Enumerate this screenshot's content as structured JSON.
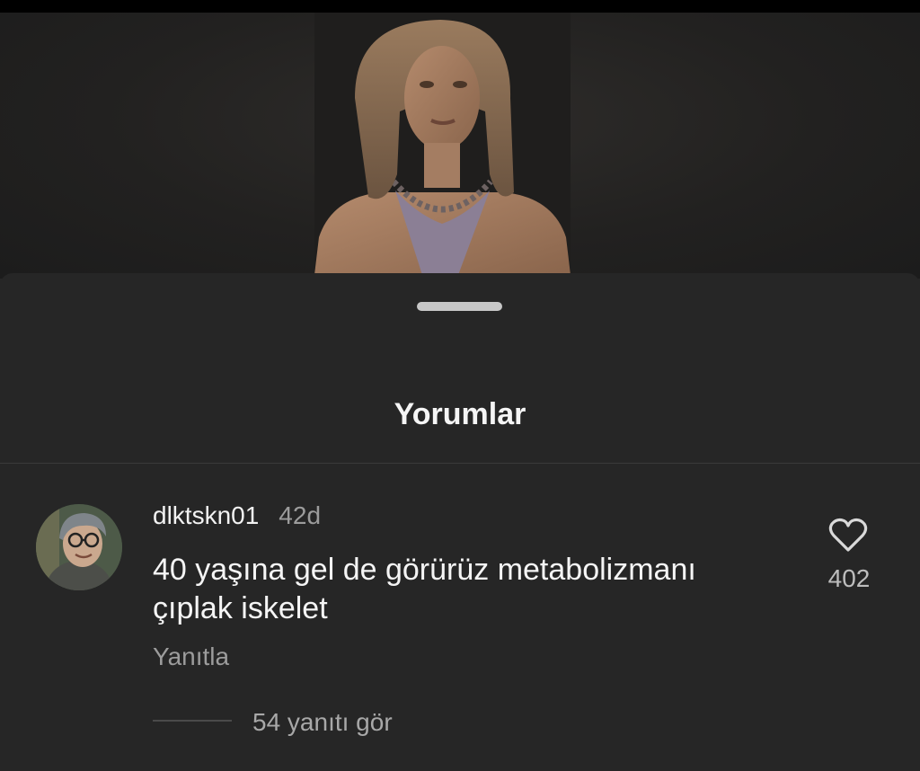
{
  "sheet": {
    "title": "Yorumlar"
  },
  "comment": {
    "username": "dlktskn01",
    "timestamp": "42d",
    "text_line1": "40 yaşına gel de görürüz metabolizmanı",
    "text_line2": "çıplak iskelet",
    "reply_label": "Yanıtla",
    "like_icon": "heart-icon",
    "like_count": "402",
    "view_replies_label": "54 yanıtı gör"
  },
  "colors": {
    "background": "#262626",
    "primary_text": "#f5f5f5",
    "secondary_text": "#9c9c9c",
    "handle": "#c7c7c7"
  }
}
